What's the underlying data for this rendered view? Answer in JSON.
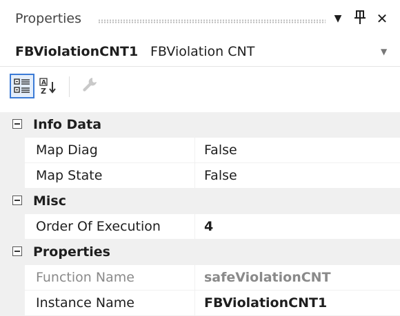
{
  "titlebar": {
    "title": "Properties",
    "dropdown_icon": "▼",
    "pin_icon": "ᚙ",
    "close_icon": "✕"
  },
  "selector": {
    "object_name": "FBViolationCNT1",
    "object_type": "FBViolation CNT",
    "arrow": "▼"
  },
  "toolbar": {
    "categorized": "categorized-icon",
    "alphabetical": "alphabetical-sort-icon",
    "property_pages": "property-pages-icon"
  },
  "grid": {
    "info_data": {
      "label": "Info Data",
      "rows": [
        {
          "name": "Map Diag",
          "value": "False"
        },
        {
          "name": "Map State",
          "value": "False"
        }
      ]
    },
    "misc": {
      "label": "Misc",
      "rows": [
        {
          "name": "Order Of Execution",
          "value": "4"
        }
      ]
    },
    "properties": {
      "label": "Properties",
      "rows": [
        {
          "name": "Function Name",
          "value": "safeViolationCNT"
        },
        {
          "name": "Instance Name",
          "value": "FBViolationCNT1"
        }
      ]
    }
  },
  "colors": {
    "category_bg": "#f0f0f0",
    "readonly_text": "#8a8a8a",
    "accent": "#3a7ad6"
  }
}
